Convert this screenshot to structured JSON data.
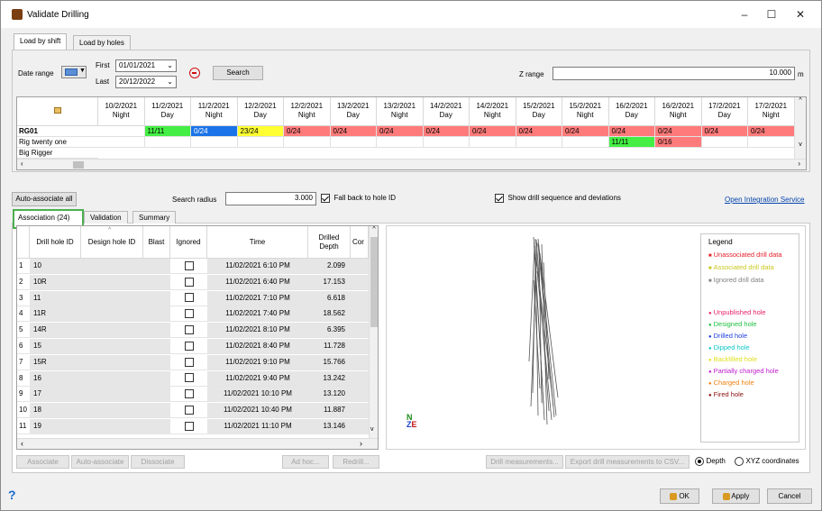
{
  "window": {
    "title": "Validate Drilling",
    "min": "–",
    "max": "☐",
    "close": "✕"
  },
  "tabs": [
    {
      "label": "Load by shift"
    },
    {
      "label": "Load by holes"
    }
  ],
  "filters": {
    "date_range_label": "Date range",
    "first_label": "First",
    "first_value": "01/01/2021",
    "last_label": "Last",
    "last_value": "20/12/2022",
    "search_label": "Search",
    "z_range_label": "Z range",
    "z_range_value": "10.000",
    "z_unit": "m"
  },
  "shift_grid": {
    "columns": [
      {
        "date": "10/2/2021",
        "shift": "Night"
      },
      {
        "date": "11/2/2021",
        "shift": "Day"
      },
      {
        "date": "11/2/2021",
        "shift": "Night"
      },
      {
        "date": "12/2/2021",
        "shift": "Day"
      },
      {
        "date": "12/2/2021",
        "shift": "Night"
      },
      {
        "date": "13/2/2021",
        "shift": "Day"
      },
      {
        "date": "13/2/2021",
        "shift": "Night"
      },
      {
        "date": "14/2/2021",
        "shift": "Day"
      },
      {
        "date": "14/2/2021",
        "shift": "Night"
      },
      {
        "date": "15/2/2021",
        "shift": "Day"
      },
      {
        "date": "15/2/2021",
        "shift": "Night"
      },
      {
        "date": "16/2/2021",
        "shift": "Day"
      },
      {
        "date": "16/2/2021",
        "shift": "Night"
      },
      {
        "date": "17/2/2021",
        "shift": "Day"
      },
      {
        "date": "17/2/2021",
        "shift": "Night"
      }
    ],
    "rows": [
      {
        "name": "RG01",
        "cells": [
          "",
          "11/11",
          "0/24",
          "23/24",
          "0/24",
          "0/24",
          "0/24",
          "0/24",
          "0/24",
          "0/24",
          "0/24",
          "0/24",
          "0/24",
          "0/24",
          "0/24"
        ],
        "colors": [
          "",
          "#44ee44",
          "#1a73e8",
          "#ffff33",
          "#ff7b7b",
          "#ff7b7b",
          "#ff7b7b",
          "#ff7b7b",
          "#ff7b7b",
          "#ff7b7b",
          "#ff7b7b",
          "#ff7b7b",
          "#ff7b7b",
          "#ff7b7b",
          "#ff7b7b"
        ]
      },
      {
        "name": "Rig twenty one",
        "cells": [
          "",
          "",
          "",
          "",
          "",
          "",
          "",
          "",
          "",
          "",
          "",
          "11/11",
          "0/16",
          "",
          ""
        ],
        "colors": [
          "",
          "",
          "",
          "",
          "",
          "",
          "",
          "",
          "",
          "",
          "",
          "#44ee44",
          "#ff7b7b",
          "",
          ""
        ]
      },
      {
        "name": "Big Rigger",
        "cells": [],
        "colors": []
      }
    ]
  },
  "middle": {
    "auto_associate_all": "Auto-associate all",
    "search_radius_label": "Search radius",
    "search_radius_value": "3.000",
    "fall_back_label": "Fall back to hole ID",
    "show_sequence_label": "Show drill sequence and deviations",
    "integration_link": "Open Integration Service"
  },
  "subtabs": [
    {
      "label": "Association (24)"
    },
    {
      "label": "Validation"
    },
    {
      "label": "Summary"
    }
  ],
  "assoc_table": {
    "headers": [
      "Drill hole ID",
      "Design hole ID",
      "Blast",
      "Ignored",
      "Time",
      "Drilled Depth",
      "Cor"
    ],
    "rows": [
      {
        "n": "1",
        "id": "10",
        "time": "11/02/2021 6:10 PM",
        "depth": "2.099"
      },
      {
        "n": "2",
        "id": "10R",
        "time": "11/02/2021 6:40 PM",
        "depth": "17.153"
      },
      {
        "n": "3",
        "id": "11",
        "time": "11/02/2021 7:10 PM",
        "depth": "6.618"
      },
      {
        "n": "4",
        "id": "11R",
        "time": "11/02/2021 7:40 PM",
        "depth": "18.562"
      },
      {
        "n": "5",
        "id": "14R",
        "time": "11/02/2021 8:10 PM",
        "depth": "6.395"
      },
      {
        "n": "6",
        "id": "15",
        "time": "11/02/2021 8:40 PM",
        "depth": "11.728"
      },
      {
        "n": "7",
        "id": "15R",
        "time": "11/02/2021 9:10 PM",
        "depth": "15.766"
      },
      {
        "n": "8",
        "id": "16",
        "time": "11/02/2021 9:40 PM",
        "depth": "13.242"
      },
      {
        "n": "9",
        "id": "17",
        "time": "11/02/2021 10:10 PM",
        "depth": "13.120"
      },
      {
        "n": "10",
        "id": "18",
        "time": "11/02/2021 10:40 PM",
        "depth": "11.887"
      },
      {
        "n": "11",
        "id": "19",
        "time": "11/02/2021 11:10 PM",
        "depth": "13.146"
      }
    ]
  },
  "legend": {
    "title": "Legend",
    "items": [
      {
        "label": "Unassociated drill data",
        "color": "#e8202a",
        "marker": "■"
      },
      {
        "label": "Associated drill data",
        "color": "#c8c820",
        "marker": "■"
      },
      {
        "label": "Ignored drill data",
        "color": "#808080",
        "marker": "■"
      },
      {
        "label": "Unpublished hole",
        "color": "#e8206a",
        "marker": "●"
      },
      {
        "label": "Designed hole",
        "color": "#20c040",
        "marker": "●"
      },
      {
        "label": "Drilled hole",
        "color": "#2040e0",
        "marker": "●"
      },
      {
        "label": "Dipped hole",
        "color": "#10c8c8",
        "marker": "●"
      },
      {
        "label": "Backfilled hole",
        "color": "#e0e020",
        "marker": "●"
      },
      {
        "label": "Partially charged hole",
        "color": "#c020d0",
        "marker": "●"
      },
      {
        "label": "Charged hole",
        "color": "#f08010",
        "marker": "●"
      },
      {
        "label": "Fired hole",
        "color": "#8a1010",
        "marker": "●"
      }
    ]
  },
  "axis": {
    "n": "N",
    "z": "Z",
    "e": "E"
  },
  "actions": {
    "associate": "Associate",
    "auto_associate": "Auto-associate",
    "dissociate": "Dissociate",
    "ad_hoc": "Ad hoc...",
    "redrill": "Redrill...",
    "drill_measurements": "Drill measurements...",
    "export_csv": "Export drill measurements to CSV...",
    "depth": "Depth",
    "xyz": "XYZ coordinates"
  },
  "footer": {
    "help": "?",
    "ok": "OK",
    "apply": "Apply",
    "cancel": "Cancel"
  }
}
